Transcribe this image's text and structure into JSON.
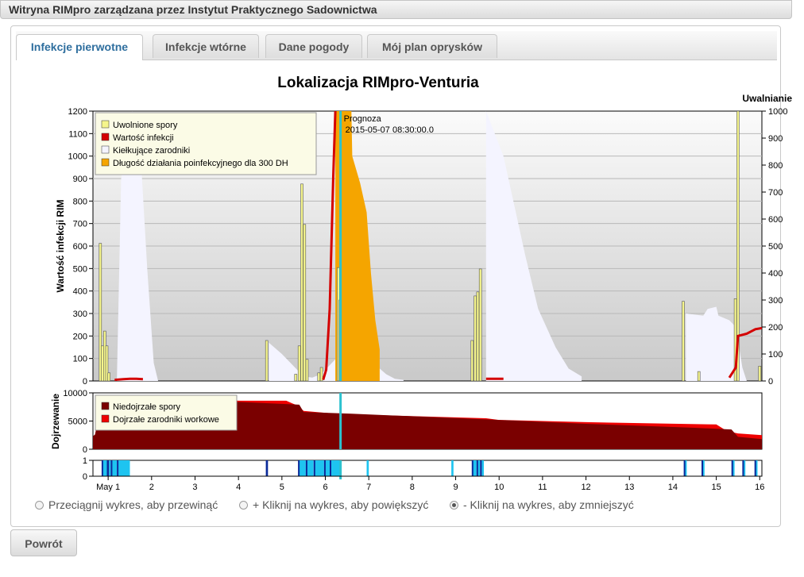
{
  "window": {
    "title": "Witryna RIMpro zarządzana przez Instytut Praktycznego Sadownictwa"
  },
  "tabs": [
    {
      "label": "Infekcje pierwotne",
      "active": true
    },
    {
      "label": "Infekcje wtórne",
      "active": false
    },
    {
      "label": "Dane pogody",
      "active": false
    },
    {
      "label": "Mój plan oprysków",
      "active": false
    }
  ],
  "chart_data": {
    "type": "line",
    "title": "Lokalizacja RIMpro-Venturia",
    "x_tick_labels": [
      "May 1",
      "2",
      "3",
      "4",
      "5",
      "6",
      "7",
      "8",
      "9",
      "10",
      "11",
      "12",
      "13",
      "14",
      "15",
      "16"
    ],
    "x_range": [
      0.65,
      16.05
    ],
    "forecast": {
      "label": "Prognoza",
      "datetime": "2015-05-07 08:30:00.0",
      "x": 6.35
    },
    "main": {
      "ylabel_left": "Wartość infekcji RIM",
      "ylabel_right": "Uwalnianie",
      "ylim_left": [
        0,
        1200
      ],
      "ylim_right": [
        0,
        1000
      ],
      "yticks_left": [
        0,
        100,
        200,
        300,
        400,
        500,
        600,
        700,
        800,
        900,
        1000,
        1100,
        1200
      ],
      "yticks_right": [
        0,
        100,
        200,
        300,
        400,
        500,
        600,
        700,
        800,
        900,
        1000
      ],
      "legend": [
        {
          "label": "Uwolnione spory",
          "color": "#f5f58c"
        },
        {
          "label": "Wartość infekcji",
          "color": "#d40000"
        },
        {
          "label": "Kiełkujące zarodniki",
          "color": "#f4f4ff"
        },
        {
          "label": "Długość działania poinfekcyjnego dla 300 DH",
          "color": "#f5a500"
        }
      ],
      "released_spores": [
        [
          0.82,
          510
        ],
        [
          0.87,
          130
        ],
        [
          0.92,
          185
        ],
        [
          0.97,
          130
        ],
        [
          1.02,
          30
        ],
        [
          4.65,
          150
        ],
        [
          5.32,
          25
        ],
        [
          5.4,
          130
        ],
        [
          5.46,
          730
        ],
        [
          5.52,
          580
        ],
        [
          5.58,
          80
        ],
        [
          5.85,
          30
        ],
        [
          5.91,
          50
        ],
        [
          6.3,
          420
        ],
        [
          6.34,
          300
        ],
        [
          9.38,
          150
        ],
        [
          9.45,
          315
        ],
        [
          9.51,
          330
        ],
        [
          9.57,
          415
        ],
        [
          14.24,
          295
        ],
        [
          14.6,
          35
        ],
        [
          15.44,
          305
        ],
        [
          15.5,
          1000
        ],
        [
          16.0,
          55
        ]
      ],
      "infection_value_segments": [
        [
          [
            1.15,
            5
          ],
          [
            1.35,
            8
          ],
          [
            1.5,
            10
          ],
          [
            1.65,
            10
          ],
          [
            1.8,
            8
          ]
        ],
        [
          [
            5.95,
            5
          ],
          [
            6.02,
            50
          ],
          [
            6.1,
            320
          ],
          [
            6.18,
            900
          ],
          [
            6.23,
            1200
          ]
        ],
        [
          [
            9.7,
            10
          ],
          [
            10.1,
            10
          ]
        ],
        [
          [
            15.3,
            15
          ],
          [
            15.45,
            60
          ],
          [
            15.5,
            200
          ],
          [
            15.7,
            210
          ],
          [
            15.9,
            230
          ],
          [
            16.05,
            235
          ]
        ]
      ],
      "germinating_spores": [
        [
          1.2,
          0
        ],
        [
          1.3,
          900
        ],
        [
          1.55,
          1200
        ],
        [
          1.75,
          1000
        ],
        [
          1.9,
          500
        ],
        [
          2.05,
          80
        ],
        [
          2.15,
          0
        ],
        [
          4.7,
          170
        ],
        [
          5.0,
          120
        ],
        [
          5.3,
          60
        ],
        [
          5.5,
          20
        ],
        [
          5.7,
          15
        ],
        [
          5.9,
          30
        ],
        [
          6.6,
          170
        ],
        [
          6.8,
          140
        ],
        [
          7.1,
          80
        ],
        [
          7.4,
          30
        ],
        [
          7.6,
          10
        ],
        [
          7.8,
          5
        ],
        [
          9.7,
          1200
        ],
        [
          10.1,
          1000
        ],
        [
          10.35,
          780
        ],
        [
          10.6,
          560
        ],
        [
          10.9,
          320
        ],
        [
          11.3,
          150
        ],
        [
          11.6,
          55
        ],
        [
          11.9,
          20
        ],
        [
          14.3,
          300
        ],
        [
          14.7,
          290
        ],
        [
          14.8,
          320
        ],
        [
          15.0,
          330
        ],
        [
          15.05,
          290
        ],
        [
          15.3,
          270
        ],
        [
          15.45,
          240
        ],
        [
          15.6,
          60
        ],
        [
          15.7,
          0
        ]
      ],
      "post_infection": [
        [
          6.23,
          1200
        ],
        [
          6.6,
          1200
        ],
        [
          6.62,
          1000
        ],
        [
          6.8,
          880
        ],
        [
          6.95,
          750
        ],
        [
          7.05,
          480
        ],
        [
          7.15,
          270
        ],
        [
          7.25,
          140
        ]
      ]
    },
    "maturation": {
      "ylabel": "Dojrzewanie",
      "ylim": [
        0,
        10000
      ],
      "yticks": [
        0,
        5000,
        10000
      ],
      "legend": [
        {
          "label": "Niedojrzałe spory",
          "color": "#7a0000"
        },
        {
          "label": "Dojrzałe zarodniki workowe",
          "color": "#ee0000"
        }
      ],
      "immature": [
        [
          0.65,
          2300
        ],
        [
          0.7,
          2600
        ],
        [
          0.85,
          8400
        ],
        [
          4.0,
          8400
        ],
        [
          5.4,
          7900
        ],
        [
          5.5,
          6600
        ],
        [
          6.6,
          6300
        ],
        [
          9.7,
          5300
        ],
        [
          12.0,
          4500
        ],
        [
          14.5,
          3800
        ],
        [
          15.35,
          3500
        ],
        [
          15.5,
          2200
        ],
        [
          16.05,
          1800
        ]
      ],
      "total": [
        [
          0.65,
          2300
        ],
        [
          0.7,
          2600
        ],
        [
          0.85,
          8800
        ],
        [
          3.5,
          8900
        ],
        [
          4.0,
          8600
        ],
        [
          5.1,
          8600
        ],
        [
          5.25,
          8100
        ],
        [
          5.35,
          7800
        ],
        [
          5.5,
          6800
        ],
        [
          6.1,
          6400
        ],
        [
          7.0,
          6100
        ],
        [
          9.7,
          5500
        ],
        [
          10.0,
          5200
        ],
        [
          12.0,
          4800
        ],
        [
          15.0,
          4400
        ],
        [
          15.25,
          3200
        ],
        [
          15.5,
          2800
        ],
        [
          16.05,
          2500
        ]
      ]
    },
    "wetness": {
      "yticks": [
        0,
        1
      ],
      "dark_bars": [
        [
          0.85,
          0.88
        ],
        [
          0.97,
          1.02
        ],
        [
          1.06,
          1.08
        ],
        [
          1.2,
          1.22
        ],
        [
          4.63,
          4.68
        ],
        [
          5.37,
          5.4
        ],
        [
          5.55,
          5.58
        ],
        [
          5.73,
          5.76
        ],
        [
          5.97,
          6.0
        ],
        [
          6.1,
          6.12
        ],
        [
          9.37,
          9.4
        ],
        [
          9.48,
          9.51
        ],
        [
          9.56,
          9.6
        ],
        [
          14.25,
          14.28
        ],
        [
          14.66,
          14.69
        ],
        [
          15.35,
          15.38
        ],
        [
          15.6,
          15.63
        ],
        [
          15.88,
          15.91
        ]
      ],
      "light_bars": [
        [
          0.88,
          0.97
        ],
        [
          1.02,
          1.06
        ],
        [
          1.08,
          1.2
        ],
        [
          1.22,
          1.5
        ],
        [
          5.4,
          5.55
        ],
        [
          5.58,
          5.73
        ],
        [
          5.76,
          5.97
        ],
        [
          6.0,
          6.1
        ],
        [
          6.12,
          6.35
        ],
        [
          6.95,
          7.0
        ],
        [
          8.9,
          8.95
        ],
        [
          9.4,
          9.48
        ],
        [
          9.51,
          9.56
        ],
        [
          9.6,
          9.65
        ],
        [
          14.28,
          14.32
        ],
        [
          14.69,
          14.73
        ],
        [
          15.38,
          15.42
        ],
        [
          15.63,
          15.67
        ],
        [
          15.91,
          15.95
        ]
      ]
    }
  },
  "options": [
    {
      "label": "Przeciągnij wykres, aby przewinąć",
      "selected": false
    },
    {
      "label": "+ Kliknij na wykres, aby powiększyć",
      "selected": false
    },
    {
      "label": "- Kliknij na wykres, aby zmniejszyć",
      "selected": true
    }
  ],
  "buttons": {
    "back": "Powrót"
  }
}
